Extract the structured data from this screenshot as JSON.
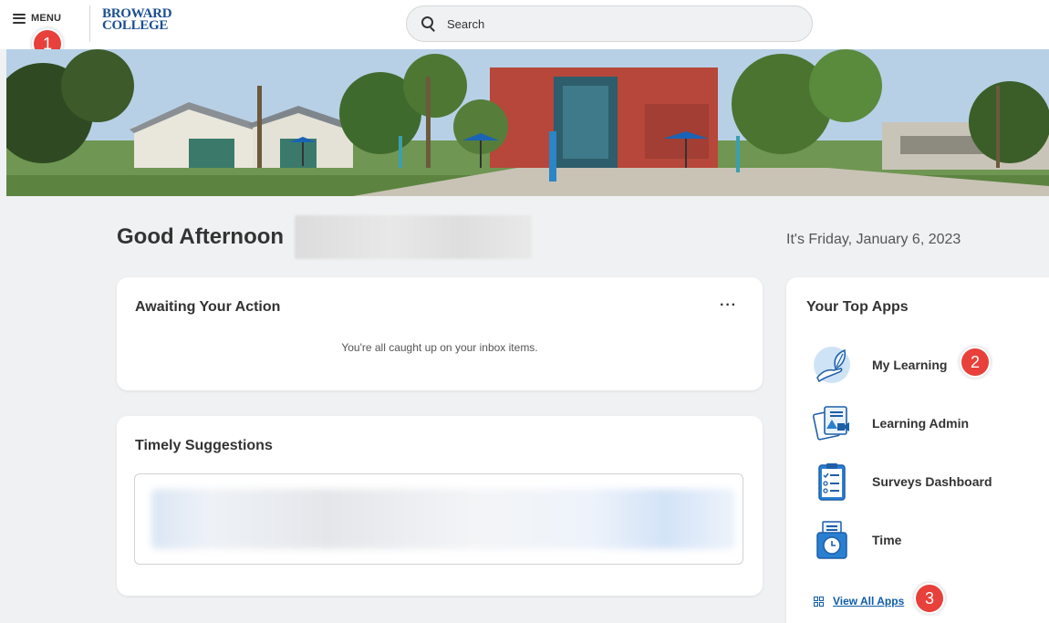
{
  "header": {
    "menu_label": "MENU",
    "logo_line1": "BROWARD",
    "logo_line2": "COLLEGE",
    "search_placeholder": "Search"
  },
  "greeting": "Good Afternoon",
  "date_text": "It's Friday, January 6, 2023",
  "awaiting_action": {
    "title": "Awaiting Your Action",
    "more_label": "···",
    "empty_message": "You're all caught up on your inbox items."
  },
  "timely_suggestions": {
    "title": "Timely Suggestions"
  },
  "top_apps": {
    "title": "Your Top Apps",
    "apps": [
      {
        "label": "My Learning",
        "icon": "learning-hand-leaf-icon"
      },
      {
        "label": "Learning Admin",
        "icon": "learning-admin-document-icon"
      },
      {
        "label": "Surveys Dashboard",
        "icon": "clipboard-checklist-icon"
      },
      {
        "label": "Time",
        "icon": "time-clock-icon"
      }
    ],
    "view_all_label": "View All Apps",
    "view_all_icon": "grid-icon"
  },
  "annotations": [
    "1",
    "2",
    "3"
  ],
  "colors": {
    "badge": "#e8403a",
    "link": "#0f5ca8",
    "logo": "#1a4f91",
    "icon_blue": "#2a7fd1"
  }
}
